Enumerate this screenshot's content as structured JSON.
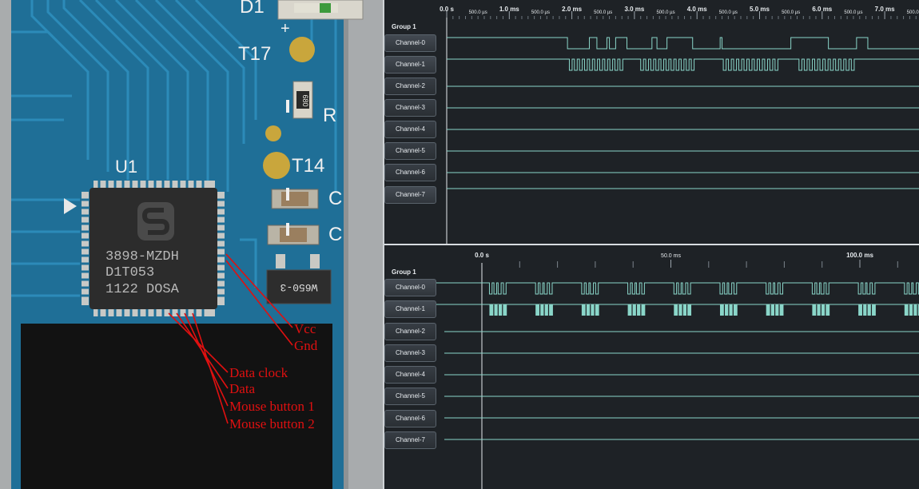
{
  "photo": {
    "silkscreen": {
      "d1": "D1",
      "t17": "T17",
      "t14": "T14",
      "u1": "U1",
      "r_partial": "R",
      "c_partial_1": "C",
      "c_partial_2": "C",
      "plus": "+"
    },
    "chip_marking": [
      "3898-MZDH",
      "D1T053",
      "1122 DOSA"
    ],
    "resistor_code": "680",
    "sot_marking": "W650-3",
    "pin_annotations": [
      "Vcc",
      "Gnd",
      "Data clock",
      "Data",
      "Mouse button 1",
      "Mouse button 2"
    ],
    "annotation_color": "#e01010"
  },
  "top_view": {
    "group": "Group 1",
    "channels": [
      "Channel-0",
      "Channel-1",
      "Channel-2",
      "Channel-3",
      "Channel-4",
      "Channel-5",
      "Channel-6",
      "Channel-7"
    ],
    "major_ticks": [
      "0.0 s",
      "1.0 ms",
      "2.0 ms",
      "3.0 ms",
      "4.0 ms",
      "5.0 ms",
      "6.0 ms",
      "7.0 ms"
    ],
    "minor_tick": "500.0 µs",
    "signal_color": "#8ad6c9"
  },
  "bottom_view": {
    "group": "Group 1",
    "channels": [
      "Channel-0",
      "Channel-1",
      "Channel-2",
      "Channel-3",
      "Channel-4",
      "Channel-5",
      "Channel-6",
      "Channel-7"
    ],
    "ticks": [
      "0.0 s",
      "50.0 ms",
      "100.0 ms"
    ],
    "signal_color": "#8ad6c9"
  }
}
